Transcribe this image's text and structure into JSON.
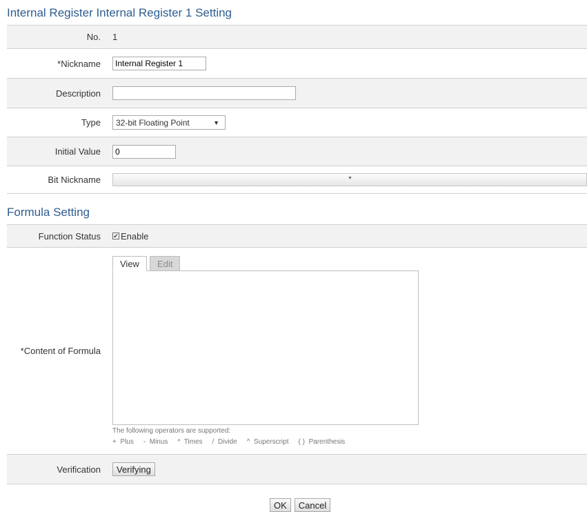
{
  "register_section": {
    "title": "Internal Register Internal Register 1 Setting",
    "no_label": "No.",
    "no_value": "1",
    "nickname_label": "*Nickname",
    "nickname_value": "Internal Register 1",
    "description_label": "Description",
    "description_value": "",
    "type_label": "Type",
    "type_value": "32-bit Floating Point",
    "initial_value_label": "Initial Value",
    "initial_value": "0",
    "bit_nickname_label": "Bit Nickname"
  },
  "formula_section": {
    "title": "Formula Setting",
    "function_status_label": "Function Status",
    "enable_label": "Enable",
    "enable_checked": true,
    "content_label": "*Content of Formula",
    "tabs": [
      {
        "label": "View",
        "active": true
      },
      {
        "label": "Edit",
        "active": false
      }
    ],
    "operators_caption": "The following operators are supported:",
    "operators": [
      "+  Plus",
      "-  Minus",
      "*  Times",
      "/  Divide",
      "^  Superscript",
      "( )  Parenthesis"
    ],
    "verification_label": "Verification",
    "verify_button": "Verifying"
  },
  "footer": {
    "ok_button": "OK",
    "cancel_button": "Cancel"
  },
  "icons": {
    "select_arrow": "caret-down-icon",
    "checkbox": "check-icon"
  },
  "colors": {
    "section_title": "#2e5d8f",
    "label_background": "#f2f2f2",
    "row_border": "#cfcfcf"
  }
}
